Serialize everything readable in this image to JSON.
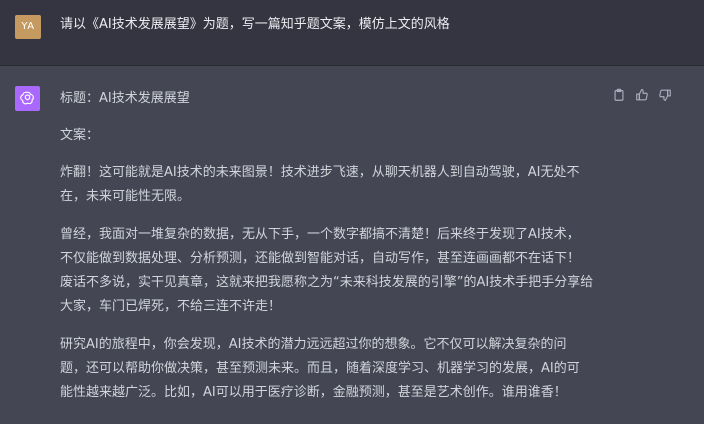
{
  "user": {
    "avatar_initials": "YA",
    "message": "请以《AI技术发展展望》为题，写一篇知乎题文案，模仿上文的风格"
  },
  "assistant": {
    "title": "标题：AI技术发展展望",
    "label": "文案：",
    "paragraphs": [
      [
        "炸翻！这可能就是AI技术的未来图景！技术进步飞速，从聊天机器人到自动驾驶，AI无处不",
        "在，未来可能性无限。"
      ],
      [
        "曾经，我面对一堆复杂的数据，无从下手，一个数字都搞不清楚！后来终于发现了AI技术，",
        "不仅能做到数据处理、分析预测，还能做到智能对话，自动写作，甚至连画画都不在话下！",
        "废话不多说，实干见真章，这就来把我愿称之为“未来科技发展的引擎”的AI技术手把手分享给",
        "大家，车门已焊死，不给三连不许走！"
      ],
      [
        "研究AI的旅程中，你会发现，AI技术的潜力远远超过你的想象。它不仅可以解决复杂的问",
        "题，还可以帮助你做决策，甚至预测未来。而且，随着深度学习、机器学习的发展，AI的可",
        "能性越来越广泛。比如，AI可以用于医疗诊断，金融预测，甚至是艺术创作。谁用谁香！"
      ]
    ],
    "actions": [
      "copy-icon",
      "thumbs-up-icon",
      "thumbs-down-icon"
    ]
  },
  "colors": {
    "user_bg": "#343541",
    "assistant_bg": "#444654",
    "user_avatar": "#c49a61",
    "gpt_avatar": "#ab68ff",
    "text": "#d1d5db"
  }
}
